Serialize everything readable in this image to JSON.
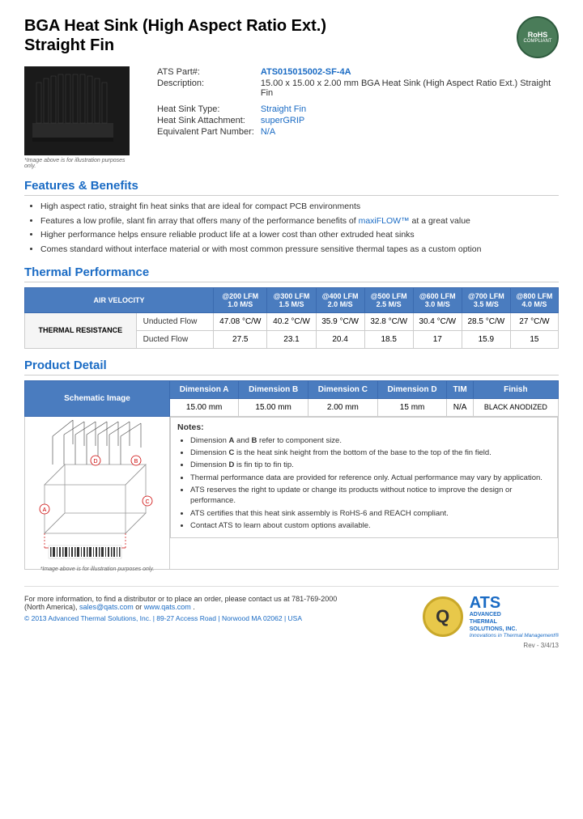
{
  "product": {
    "title_line1": "BGA Heat Sink (High Aspect Ratio Ext.)",
    "title_line2": "Straight Fin",
    "ats_part_label": "ATS Part#:",
    "ats_part_value": "ATS015015002-SF-4A",
    "description_label": "Description:",
    "description_value": "15.00 x 15.00 x 2.00 mm  BGA Heat Sink (High Aspect Ratio Ext.) Straight Fin",
    "heat_sink_type_label": "Heat Sink Type:",
    "heat_sink_type_value": "Straight Fin",
    "attachment_label": "Heat Sink Attachment:",
    "attachment_value": "superGRIP",
    "equivalent_label": "Equivalent Part Number:",
    "equivalent_value": "N/A",
    "image_caption": "*Image above is for illustration purposes only."
  },
  "features": {
    "section_title": "Features & Benefits",
    "items": [
      "High aspect ratio, straight fin heat sinks that are ideal for compact PCB environments",
      "Features a low profile, slant fin array that offers many of the performance benefits of maxiFLOW™ at a great value",
      "Higher performance helps ensure reliable product life at a lower cost than other extruded heat sinks",
      "Comes standard without interface material or with most common pressure sensitive thermal tapes as a custom option"
    ],
    "maxiflow_link": "maxiFLOW™"
  },
  "thermal": {
    "section_title": "Thermal Performance",
    "table": {
      "air_velocity_label": "AIR VELOCITY",
      "columns": [
        {
          "lfm": "@200 LFM",
          "ms": "1.0 M/S"
        },
        {
          "lfm": "@300 LFM",
          "ms": "1.5 M/S"
        },
        {
          "lfm": "@400 LFM",
          "ms": "2.0 M/S"
        },
        {
          "lfm": "@500 LFM",
          "ms": "2.5 M/S"
        },
        {
          "lfm": "@600 LFM",
          "ms": "3.0 M/S"
        },
        {
          "lfm": "@700 LFM",
          "ms": "3.5 M/S"
        },
        {
          "lfm": "@800 LFM",
          "ms": "4.0 M/S"
        }
      ],
      "row_header": "THERMAL RESISTANCE",
      "rows": [
        {
          "label": "Unducted Flow",
          "values": [
            "47.08 °C/W",
            "40.2 °C/W",
            "35.9 °C/W",
            "32.8 °C/W",
            "30.4 °C/W",
            "28.5 °C/W",
            "27 °C/W"
          ]
        },
        {
          "label": "Ducted Flow",
          "values": [
            "27.5",
            "23.1",
            "20.4",
            "18.5",
            "17",
            "15.9",
            "15"
          ]
        }
      ]
    }
  },
  "product_detail": {
    "section_title": "Product Detail",
    "table_headers": [
      "Schematic Image",
      "Dimension A",
      "Dimension B",
      "Dimension C",
      "Dimension D",
      "TIM",
      "Finish"
    ],
    "values": {
      "dimension_a": "15.00 mm",
      "dimension_b": "15.00 mm",
      "dimension_c": "2.00 mm",
      "dimension_d": "15 mm",
      "tim": "N/A",
      "finish": "BLACK ANODIZED"
    },
    "schematic_caption": "*Image above is for illustration purposes only.",
    "notes_title": "Notes:",
    "notes": [
      "Dimension A and B refer to component size.",
      "Dimension C is the heat sink height from the bottom of the base to the top of the fin field.",
      "Dimension D is fin tip to fin tip.",
      "Thermal performance data are provided for reference only. Actual performance may vary by application.",
      "ATS reserves the right to update or change its products without notice to improve the design or performance.",
      "ATS certifies that this heat sink assembly is RoHS-6 and REACH compliant.",
      "Contact ATS to learn about custom options available."
    ]
  },
  "footer": {
    "contact_text": "For more information, to find a distributor or to place an order, please contact us at 781-769-2000 (North America),",
    "email": "sales@qats.com",
    "website": "www.qats.com",
    "copyright": "© 2013 Advanced Thermal Solutions, Inc. | 89-27 Access Road  |  Norwood MA  02062  |  USA",
    "ats_letter": "Q",
    "ats_brand": "ATS",
    "ats_name_line1": "ADVANCED",
    "ats_name_line2": "THERMAL",
    "ats_name_line3": "SOLUTIONS, INC.",
    "tagline": "Innovations in Thermal Management®",
    "rev": "Rev - 3/4/13"
  },
  "rohs": {
    "label1": "RoHS",
    "label2": "COMPLIANT"
  }
}
